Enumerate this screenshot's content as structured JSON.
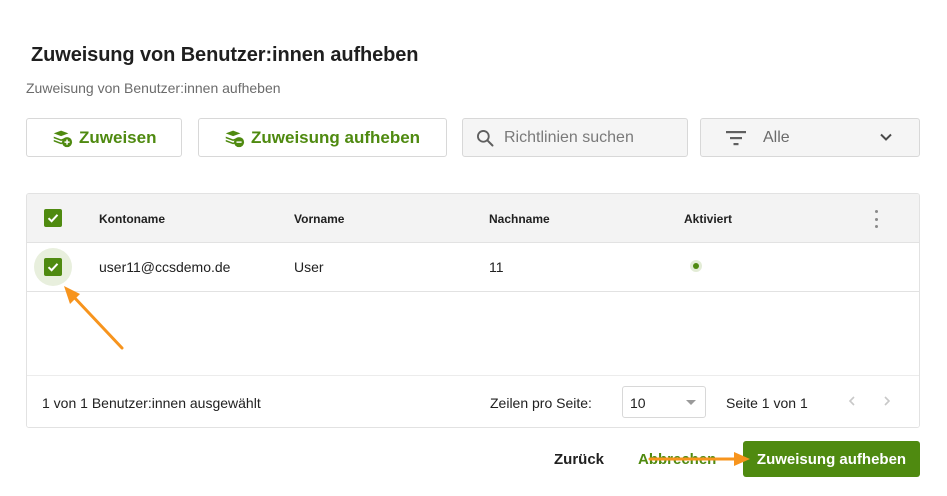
{
  "dialog": {
    "title": "Zuweisung von Benutzer:innen aufheben",
    "subtitle": "Zuweisung von Benutzer:innen aufheben"
  },
  "toolbar": {
    "assign_label": "Zuweisen",
    "unassign_label": "Zuweisung aufheben",
    "search_placeholder": "Richtlinien suchen",
    "filter_value": "Alle"
  },
  "table": {
    "columns": [
      "Kontoname",
      "Vorname",
      "Nachname",
      "Aktiviert"
    ],
    "rows": [
      {
        "account": "user11@ccsdemo.de",
        "first_name": "User",
        "last_name": "11",
        "enabled": true,
        "selected": true
      }
    ]
  },
  "footer": {
    "selected_text": "1 von 1 Benutzer:innen ausgewählt",
    "rows_per_page_label": "Zeilen pro Seite:",
    "rows_per_page_value": "10",
    "page_info": "Seite 1 von 1"
  },
  "actions": {
    "back_label": "Zurück",
    "cancel_label": "Abbrechen",
    "confirm_label": "Zuweisung aufheben"
  },
  "colors": {
    "accent": "#4f8a10",
    "annotation_arrow": "#f7941d"
  }
}
